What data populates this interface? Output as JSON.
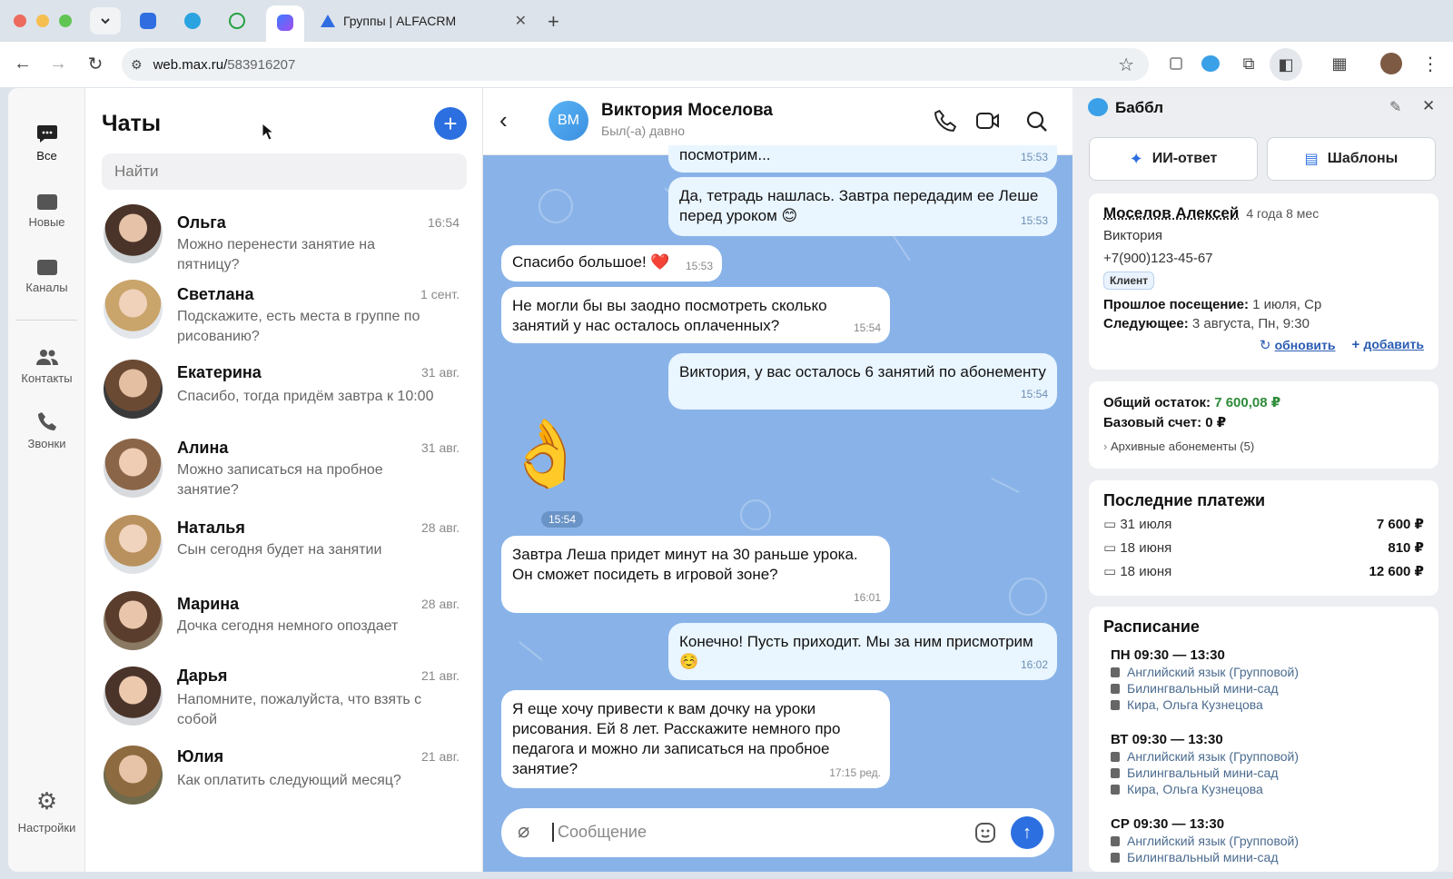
{
  "browser": {
    "tab_title": "Группы | ALFACRM",
    "url_host": "web.max.ru/",
    "url_path": "583916207"
  },
  "rail": {
    "items": [
      {
        "label": "Все",
        "icon": "chat-bubble-icon"
      },
      {
        "label": "Новые",
        "icon": "folder-icon"
      },
      {
        "label": "Каналы",
        "icon": "folder-icon"
      },
      {
        "label": "Контакты",
        "icon": "people-icon"
      },
      {
        "label": "Звонки",
        "icon": "phone-icon"
      }
    ],
    "settings_label": "Настройки"
  },
  "chats": {
    "title": "Чаты",
    "search_placeholder": "Найти",
    "list": [
      {
        "name": "Ольга",
        "date": "16:54",
        "preview": "Можно перенести занятие на пятницу?"
      },
      {
        "name": "Светлана",
        "date": "1 сент.",
        "preview": "Подскажите, есть места в группе по рисованию?"
      },
      {
        "name": "Екатерина",
        "date": "31 авг.",
        "preview": "Спасибо, тогда придём завтра к 10:00"
      },
      {
        "name": "Алина",
        "date": "31 авг.",
        "preview": "Можно записаться на пробное занятие?"
      },
      {
        "name": "Наталья",
        "date": "28 авг.",
        "preview": "Сын сегодня будет на занятии"
      },
      {
        "name": "Марина",
        "date": "28 авг.",
        "preview": "Дочка сегодня немного опоздает"
      },
      {
        "name": "Дарья",
        "date": "21 авг.",
        "preview": "Напомните, пожалуйста, что взять с собой"
      },
      {
        "name": "Юлия",
        "date": "21 авг.",
        "preview": "Как оплатить следующий месяц?"
      }
    ]
  },
  "conversation": {
    "initials": "ВМ",
    "name": "Виктория Моселова",
    "status": "Был(-а) давно",
    "messages": [
      {
        "dir": "out",
        "text": "посмотрим...",
        "time": "15:53"
      },
      {
        "dir": "out",
        "text": "Да, тетрадь нашлась. Завтра передадим ее Леше перед уроком 😊",
        "time": "15:53"
      },
      {
        "dir": "in",
        "text": "Спасибо большое! ❤️",
        "time": "15:53"
      },
      {
        "dir": "in",
        "text": "Не могли бы вы заодно посмотреть сколько занятий у нас осталось оплаченных?",
        "time": "15:54"
      },
      {
        "dir": "out",
        "text": "Виктория, у вас осталось 6 занятий по абонементу",
        "time": "15:54"
      },
      {
        "dir": "in",
        "text": "👌",
        "time": "15:54"
      },
      {
        "dir": "in",
        "text": "Завтра Леша придет минут на 30 раньше урока. Он сможет посидеть в игровой зоне?",
        "time": "16:01"
      },
      {
        "dir": "out",
        "text": "Конечно! Пусть приходит. Мы за ним присмотрим ☺️",
        "time": "16:02"
      },
      {
        "dir": "in",
        "text": "Я еще хочу привести к вам дочку на уроки рисования. Ей 8 лет. Расскажите немного про педагога и можно ли записаться на пробное занятие?",
        "time": "17:15 ред."
      }
    ],
    "input_placeholder": "Сообщение"
  },
  "side": {
    "title": "Баббл",
    "ai_button": "ИИ-ответ",
    "templates_button": "Шаблоны",
    "client": {
      "name": "Моселов Алексей",
      "age": "4 года 8 мес",
      "parent": "Виктория",
      "phone": "+7(900)123-45-67",
      "badge": "Клиент",
      "prev_label": "Прошлое посещение:",
      "prev_value": "1 июля, Ср",
      "next_label": "Следующее:",
      "next_value": "3 августа, Пн, 9:30",
      "refresh": "обновить",
      "add": "добавить"
    },
    "balance": {
      "total_label": "Общий остаток:",
      "total_value": "7 600,08 ₽",
      "base_label": "Базовый счет:",
      "base_value": "0 ₽",
      "archive": "Архивные абонементы (5)"
    },
    "payments": {
      "title": "Последние платежи",
      "rows": [
        {
          "date": "31 июля",
          "amount": "7 600 ₽"
        },
        {
          "date": "18 июня",
          "amount": "810 ₽"
        },
        {
          "date": "18 июня",
          "amount": "12 600 ₽"
        }
      ]
    },
    "schedule": {
      "title": "Расписание",
      "items": [
        {
          "time": "ПН 09:30 — 13:30",
          "subject": "Английский язык (Групповой)",
          "group": "Билингвальный мини-сад",
          "teachers": "Кира, Ольга Кузнецова"
        },
        {
          "time": "ВТ 09:30 — 13:30",
          "subject": "Английский язык (Групповой)",
          "group": "Билингвальный мини-сад",
          "teachers": "Кира, Ольга Кузнецова"
        },
        {
          "time": "СР 09:30 — 13:30",
          "subject": "Английский язык (Групповой)",
          "group": "Билингвальный мини-сад",
          "teachers": ""
        }
      ]
    }
  }
}
